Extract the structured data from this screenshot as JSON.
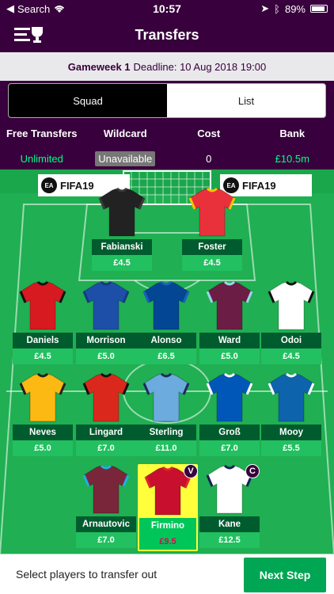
{
  "status_bar": {
    "back_label": "Search",
    "time": "10:57",
    "battery": "89%"
  },
  "header": {
    "title": "Transfers",
    "menu_icon": "menu-trophy-icon"
  },
  "deadline": {
    "gameweek": "Gameweek 1",
    "text": "Deadline: 10 Aug 2018 19:00"
  },
  "toggle": {
    "squad": "Squad",
    "list": "List",
    "active": "squad"
  },
  "stats": {
    "free_transfers": {
      "label": "Free Transfers",
      "value": "Unlimited"
    },
    "wildcard": {
      "label": "Wildcard",
      "value": "Unavailable"
    },
    "cost": {
      "label": "Cost",
      "value": "0"
    },
    "bank": {
      "label": "Bank",
      "value": "£10.5m"
    }
  },
  "ads": {
    "left": "FIFA19",
    "right": "FIFA19",
    "ea": "EA"
  },
  "players": {
    "gk": [
      {
        "name": "Fabianski",
        "price": "£4.5",
        "shirt": "#222222",
        "trim": "#3a3a3a"
      },
      {
        "name": "Foster",
        "price": "£4.5",
        "shirt": "#e8313a",
        "trim": "#f7c600"
      }
    ],
    "def": [
      {
        "name": "Daniels",
        "price": "£4.5",
        "shirt": "#d71920",
        "trim": "#111111"
      },
      {
        "name": "Morrison",
        "price": "£5.0",
        "shirt": "#1e4fa8",
        "trim": "#143a7e"
      },
      {
        "name": "Alonso",
        "price": "£6.5",
        "shirt": "#034694",
        "trim": "#1b5fbf"
      },
      {
        "name": "Ward",
        "price": "£5.0",
        "shirt": "#6c1d45",
        "trim": "#99d6ea"
      },
      {
        "name": "Odoi",
        "price": "£4.5",
        "shirt": "#ffffff",
        "trim": "#111111"
      }
    ],
    "mid": [
      {
        "name": "Neves",
        "price": "£5.0",
        "shirt": "#fdb913",
        "trim": "#231f20"
      },
      {
        "name": "Lingard",
        "price": "£7.0",
        "shirt": "#da291c",
        "trim": "#111111"
      },
      {
        "name": "Sterling",
        "price": "£11.0",
        "shirt": "#6cabdd",
        "trim": "#1c2c5b"
      },
      {
        "name": "Groß",
        "price": "£7.0",
        "shirt": "#0057b8",
        "trim": "#ffffff"
      },
      {
        "name": "Mooy",
        "price": "£5.5",
        "shirt": "#0e63ad",
        "trim": "#ffffff"
      }
    ],
    "fwd": [
      {
        "name": "Arnautovic",
        "price": "£7.0",
        "shirt": "#7a263a",
        "trim": "#1bb1e7"
      },
      {
        "name": "Firmino",
        "price": "£9.5",
        "shirt": "#c8102e",
        "trim": "#e3242b",
        "badge": "V"
      },
      {
        "name": "Kane",
        "price": "£12.5",
        "shirt": "#ffffff",
        "trim": "#132257",
        "badge": "C"
      }
    ]
  },
  "footer": {
    "message": "Select players to transfer out",
    "next": "Next Step"
  }
}
